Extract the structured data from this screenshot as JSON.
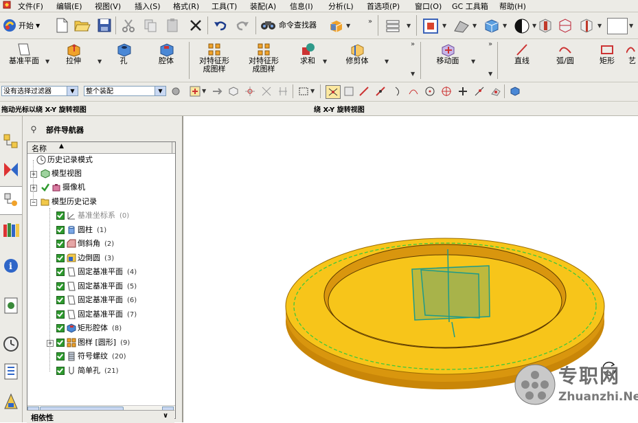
{
  "menubar": {
    "items": [
      "文件(F)",
      "编辑(E)",
      "视图(V)",
      "插入(S)",
      "格式(R)",
      "工具(T)",
      "装配(A)",
      "信息(I)",
      "分析(L)",
      "首选项(P)",
      "窗口(O)",
      "GC 工具箱",
      "帮助(H)"
    ]
  },
  "toolbar1": {
    "start_label": "开始",
    "command_finder_label": "命令查找器"
  },
  "toolbar2": {
    "datum_plane": "基准平面",
    "extrude": "拉伸",
    "hole": "孔",
    "pocket": "腔体",
    "pattern_feature_1a": "对特征形",
    "pattern_feature_1b": "成图样",
    "pattern_feature_2a": "对特征形",
    "pattern_feature_2b": "成图样",
    "unite": "求和",
    "trim_body": "修剪体",
    "move_face": "移动面",
    "line": "直线",
    "arc_circle": "弧/圆",
    "rectangle": "矩形",
    "art": "艺"
  },
  "toolbar3": {
    "filter_value": "没有选择过滤器",
    "scope_value": "整个装配"
  },
  "status": {
    "left_text": "拖动光标以绕 X-Y 旋转视图",
    "right_text": "绕 X-Y 旋转视图"
  },
  "navigator": {
    "title": "部件导航器",
    "column_name": "名称",
    "dependency_label": "相依性",
    "tree": [
      {
        "label": "历史记录模式",
        "num": ""
      },
      {
        "label": "模型视图",
        "num": ""
      },
      {
        "label": "摄像机",
        "num": ""
      },
      {
        "label": "模型历史记录",
        "num": ""
      },
      {
        "label": "基准坐标系",
        "num": "(0)"
      },
      {
        "label": "圆柱",
        "num": "(1)"
      },
      {
        "label": "倒斜角",
        "num": "(2)"
      },
      {
        "label": "边倒圆",
        "num": "(3)"
      },
      {
        "label": "固定基准平面",
        "num": "(4)"
      },
      {
        "label": "固定基准平面",
        "num": "(5)"
      },
      {
        "label": "固定基准平面",
        "num": "(6)"
      },
      {
        "label": "固定基准平面",
        "num": "(7)"
      },
      {
        "label": "矩形腔体",
        "num": "(8)"
      },
      {
        "label": "图样 [圆形]",
        "num": "(9)"
      },
      {
        "label": "符号螺纹",
        "num": "(20)"
      },
      {
        "label": "简单孔",
        "num": "(21)"
      }
    ]
  },
  "watermark": {
    "brand": "专职网",
    "url": "Zhuanzhi.Net"
  },
  "colors": {
    "part_face": "#f7c51a",
    "part_side": "#d99a10",
    "datum_plane": "#8fae5a",
    "datum_edge": "#1c9a8a",
    "dashed_edge": "#3cc83c"
  }
}
